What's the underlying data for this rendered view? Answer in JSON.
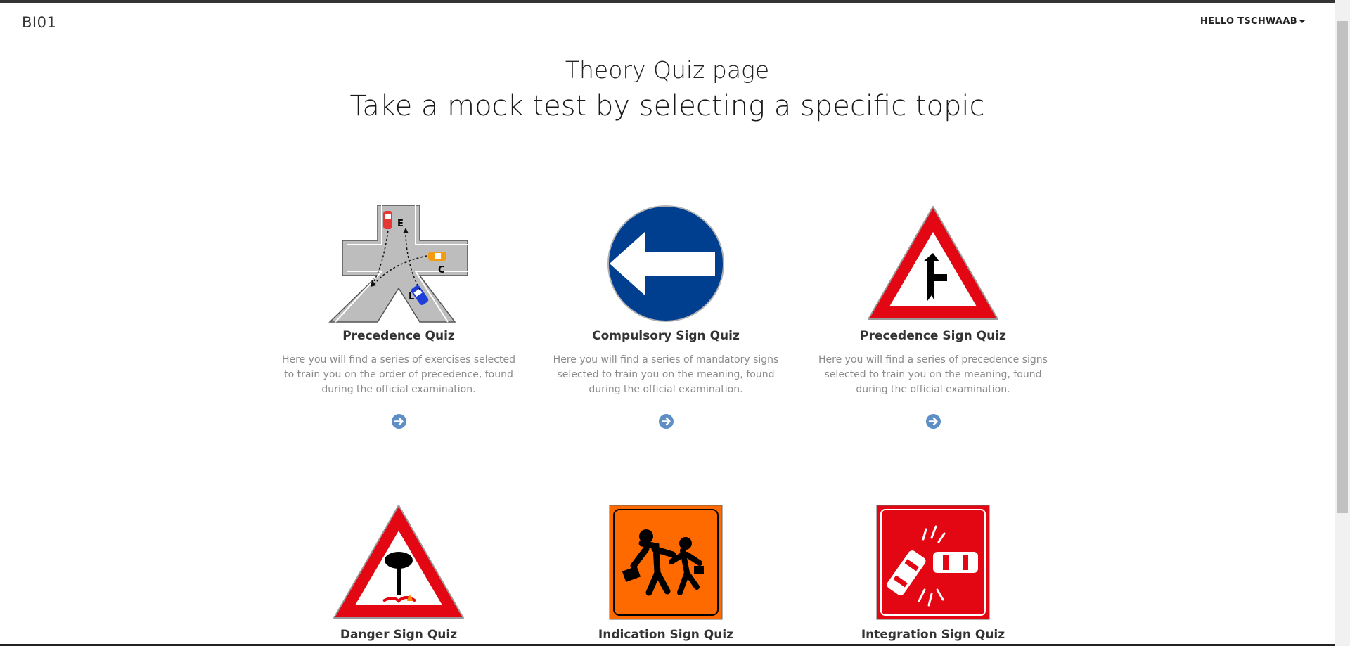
{
  "navbar": {
    "brand": "BI01",
    "user_menu": "HELLO TSCHWAAB"
  },
  "header": {
    "title": "Theory Quiz page",
    "subtitle": "Take a mock test by selecting a specific topic"
  },
  "cards": [
    {
      "title": "Precedence Quiz",
      "description": "Here you will find a series of exercises selected to train you on the order of precedence, found during the official examination.",
      "labels": [
        "E",
        "C",
        "L"
      ]
    },
    {
      "title": "Compulsory Sign Quiz",
      "description": "Here you will find a series of mandatory signs selected to train you on the meaning, found during the official examination."
    },
    {
      "title": "Precedence Sign Quiz",
      "description": "Here you will find a series of precedence signs selected to train you on the meaning, found during the official examination."
    },
    {
      "title": "Danger Sign Quiz"
    },
    {
      "title": "Indication Sign Quiz"
    },
    {
      "title": "Integration Sign Quiz"
    }
  ],
  "colors": {
    "accent": "#5d8fc6",
    "sign_red": "#e30613",
    "sign_blue": "#003f8f",
    "sign_orange": "#ff6a00"
  }
}
